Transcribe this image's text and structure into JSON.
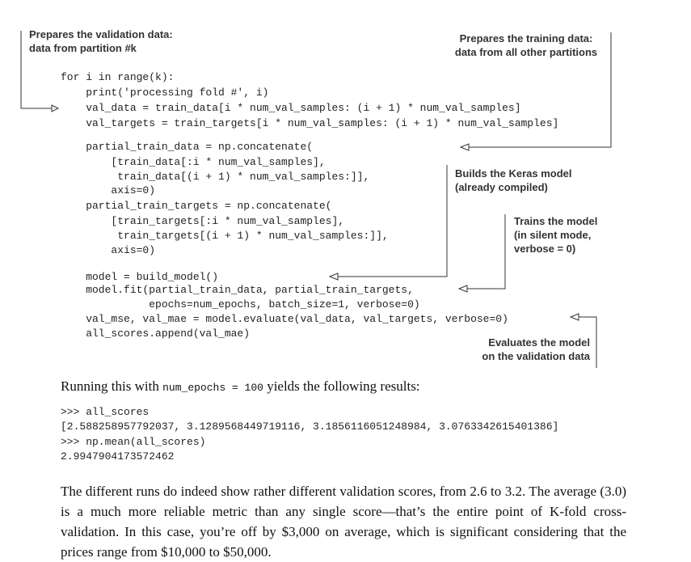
{
  "annotations": {
    "validation": [
      "Prepares the validation data:",
      "data from partition #k"
    ],
    "training": [
      "Prepares the training data:",
      "data from all other partitions"
    ],
    "build": [
      "Builds the Keras model",
      "(already compiled)"
    ],
    "train": [
      "Trains the model",
      "(in silent mode,",
      "verbose = 0)"
    ],
    "evaluate": [
      "Evaluates the model",
      "on the validation data"
    ]
  },
  "code": [
    "for i in range(k):",
    "    print('processing fold #', i)",
    "    val_data = train_data[i * num_val_samples: (i + 1) * num_val_samples]",
    "    val_targets = train_targets[i * num_val_samples: (i + 1) * num_val_samples]",
    "",
    "    partial_train_data = np.concatenate(",
    "        [train_data[:i * num_val_samples],",
    "         train_data[(i + 1) * num_val_samples:]],",
    "        axis=0)",
    "    partial_train_targets = np.concatenate(",
    "        [train_targets[:i * num_val_samples],",
    "         train_targets[(i + 1) * num_val_samples:]],",
    "        axis=0)",
    "",
    "    model = build_model()",
    "    model.fit(partial_train_data, partial_train_targets,",
    "              epochs=num_epochs, batch_size=1, verbose=0)",
    "    val_mse, val_mae = model.evaluate(val_data, val_targets, verbose=0)",
    "    all_scores.append(val_mae)"
  ],
  "running": {
    "before": "Running this with ",
    "code": "num_epochs = 100",
    "after": " yields the following results:"
  },
  "console": [
    ">>> all_scores",
    "[2.588258957792037, 3.1289568449719116, 3.1856116051248984, 3.0763342615401386]",
    ">>> np.mean(all_scores)",
    "2.9947904173572462"
  ],
  "paragraph": "The different runs do indeed show rather different validation scores, from 2.6 to 3.2. The average (3.0) is a much more reliable metric than any single score—that’s the entire point of K-fold cross-validation. In this case, you’re off by $3,000 on average, which is significant considering that the prices range from $10,000 to $50,000."
}
